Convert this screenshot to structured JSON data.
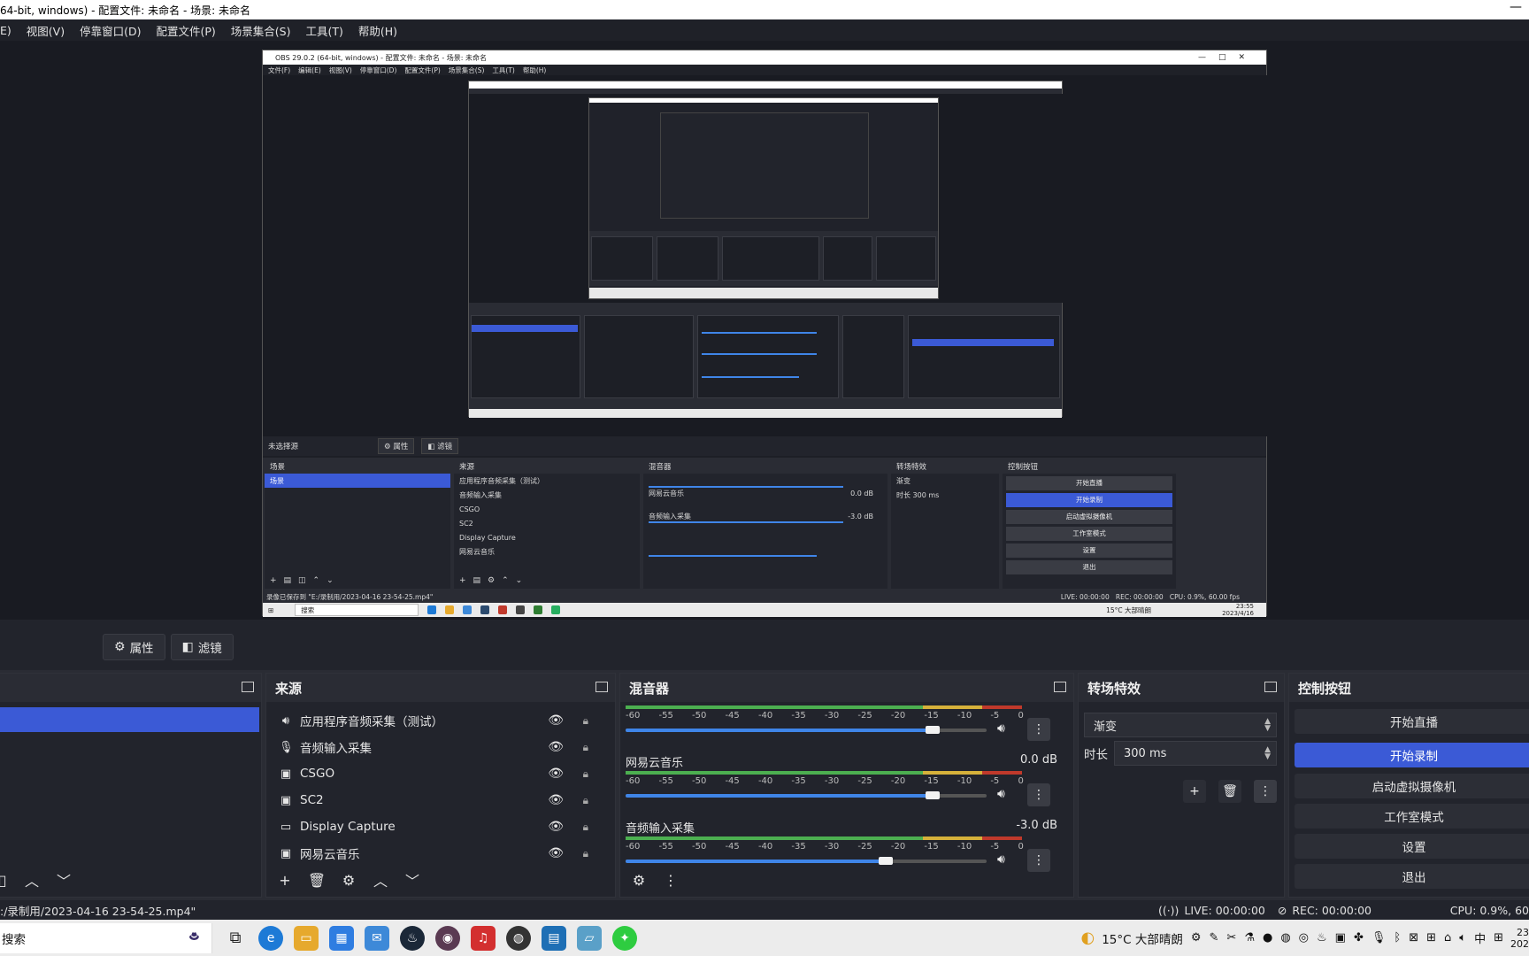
{
  "window": {
    "title": "64-bit, windows) - 配置文件: 未命名 - 场景: 未命名"
  },
  "menu": [
    "E)",
    "视图(V)",
    "停靠窗口(D)",
    "配置文件(P)",
    "场景集合(S)",
    "工具(T)",
    "帮助(H)"
  ],
  "nested": {
    "title": "OBS 29.0.2 (64-bit, windows) - 配置文件: 未命名 - 场景: 未命名",
    "menu": [
      "文件(F)",
      "编辑(E)",
      "视图(V)",
      "停靠窗口(D)",
      "配置文件(P)",
      "场景集合(S)",
      "工具(T)",
      "帮助(H)"
    ],
    "no_source": "未选择源",
    "props": "属性",
    "filters": "滤镜",
    "scenes_title": "场景",
    "scene_item": "场景",
    "sources_title": "来源",
    "sources": [
      "应用程序音频采集（测试）",
      "音频输入采集",
      "CSGO",
      "SC2",
      "Display Capture",
      "网易云音乐"
    ],
    "mixer_title": "混音器",
    "mixer": [
      {
        "name": "网易云音乐",
        "db": "0.0 dB"
      },
      {
        "name": "音频输入采集",
        "db": "-3.0 dB"
      }
    ],
    "transitions_title": "转场特效",
    "transition": "渐变",
    "duration_label": "时长",
    "duration": "300 ms",
    "controls_title": "控制按钮",
    "controls": [
      "开始直播",
      "开始录制",
      "启动虚拟摄像机",
      "工作室模式",
      "设置",
      "退出"
    ],
    "status_left": "录像已保存到 \"E:/录制用/2023-04-16 23-54-25.mp4\"",
    "status_live": "LIVE: 00:00:00",
    "status_rec": "REC: 00:00:00",
    "status_cpu": "CPU: 0.9%, 60.00 fps",
    "search": "搜索",
    "weather": "15°C 大部晴朗",
    "time": "23:55",
    "date": "2023/4/16"
  },
  "toolbar": {
    "props_label": "属性",
    "filters_label": "滤镜"
  },
  "sources": {
    "title": "来源",
    "items": [
      {
        "label": "应用程序音频采集（测试）",
        "icon": "speaker-icon"
      },
      {
        "label": "音频输入采集",
        "icon": "microphone-icon"
      },
      {
        "label": "CSGO",
        "icon": "game-capture-icon"
      },
      {
        "label": "SC2",
        "icon": "game-capture-icon"
      },
      {
        "label": "Display Capture",
        "icon": "monitor-icon"
      },
      {
        "label": "网易云音乐",
        "icon": "window-capture-icon"
      }
    ]
  },
  "mixer": {
    "title": "混音器",
    "scale": [
      "-60",
      "-55",
      "-50",
      "-45",
      "-40",
      "-35",
      "-30",
      "-25",
      "-20",
      "-15",
      "-10",
      "-5",
      "0"
    ],
    "channels": [
      {
        "name": "",
        "db": "",
        "volume": 0.85
      },
      {
        "name": "网易云音乐",
        "db": "0.0 dB",
        "volume": 0.85
      },
      {
        "name": "音频输入采集",
        "db": "-3.0 dB",
        "volume": 0.72
      }
    ]
  },
  "transitions": {
    "title": "转场特效",
    "selected": "渐变",
    "duration_label": "时长",
    "duration": "300 ms"
  },
  "controls": {
    "title": "控制按钮",
    "buttons": [
      "开始直播",
      "开始录制",
      "启动虚拟摄像机",
      "工作室模式",
      "设置",
      "退出"
    ]
  },
  "status": {
    "left": ":/录制用/2023-04-16 23-54-25.mp4\"",
    "live": "LIVE: 00:00:00",
    "rec": "REC: 00:00:00",
    "cpu": "CPU: 0.9%, 60"
  },
  "taskbar": {
    "search": "搜索",
    "weather": "15°C  大部晴朗",
    "ime": "中",
    "time": "23",
    "date": "202"
  },
  "colors": {
    "accent": "#3b5ad6",
    "panel": "#22242c",
    "background": "#1d1f26"
  }
}
